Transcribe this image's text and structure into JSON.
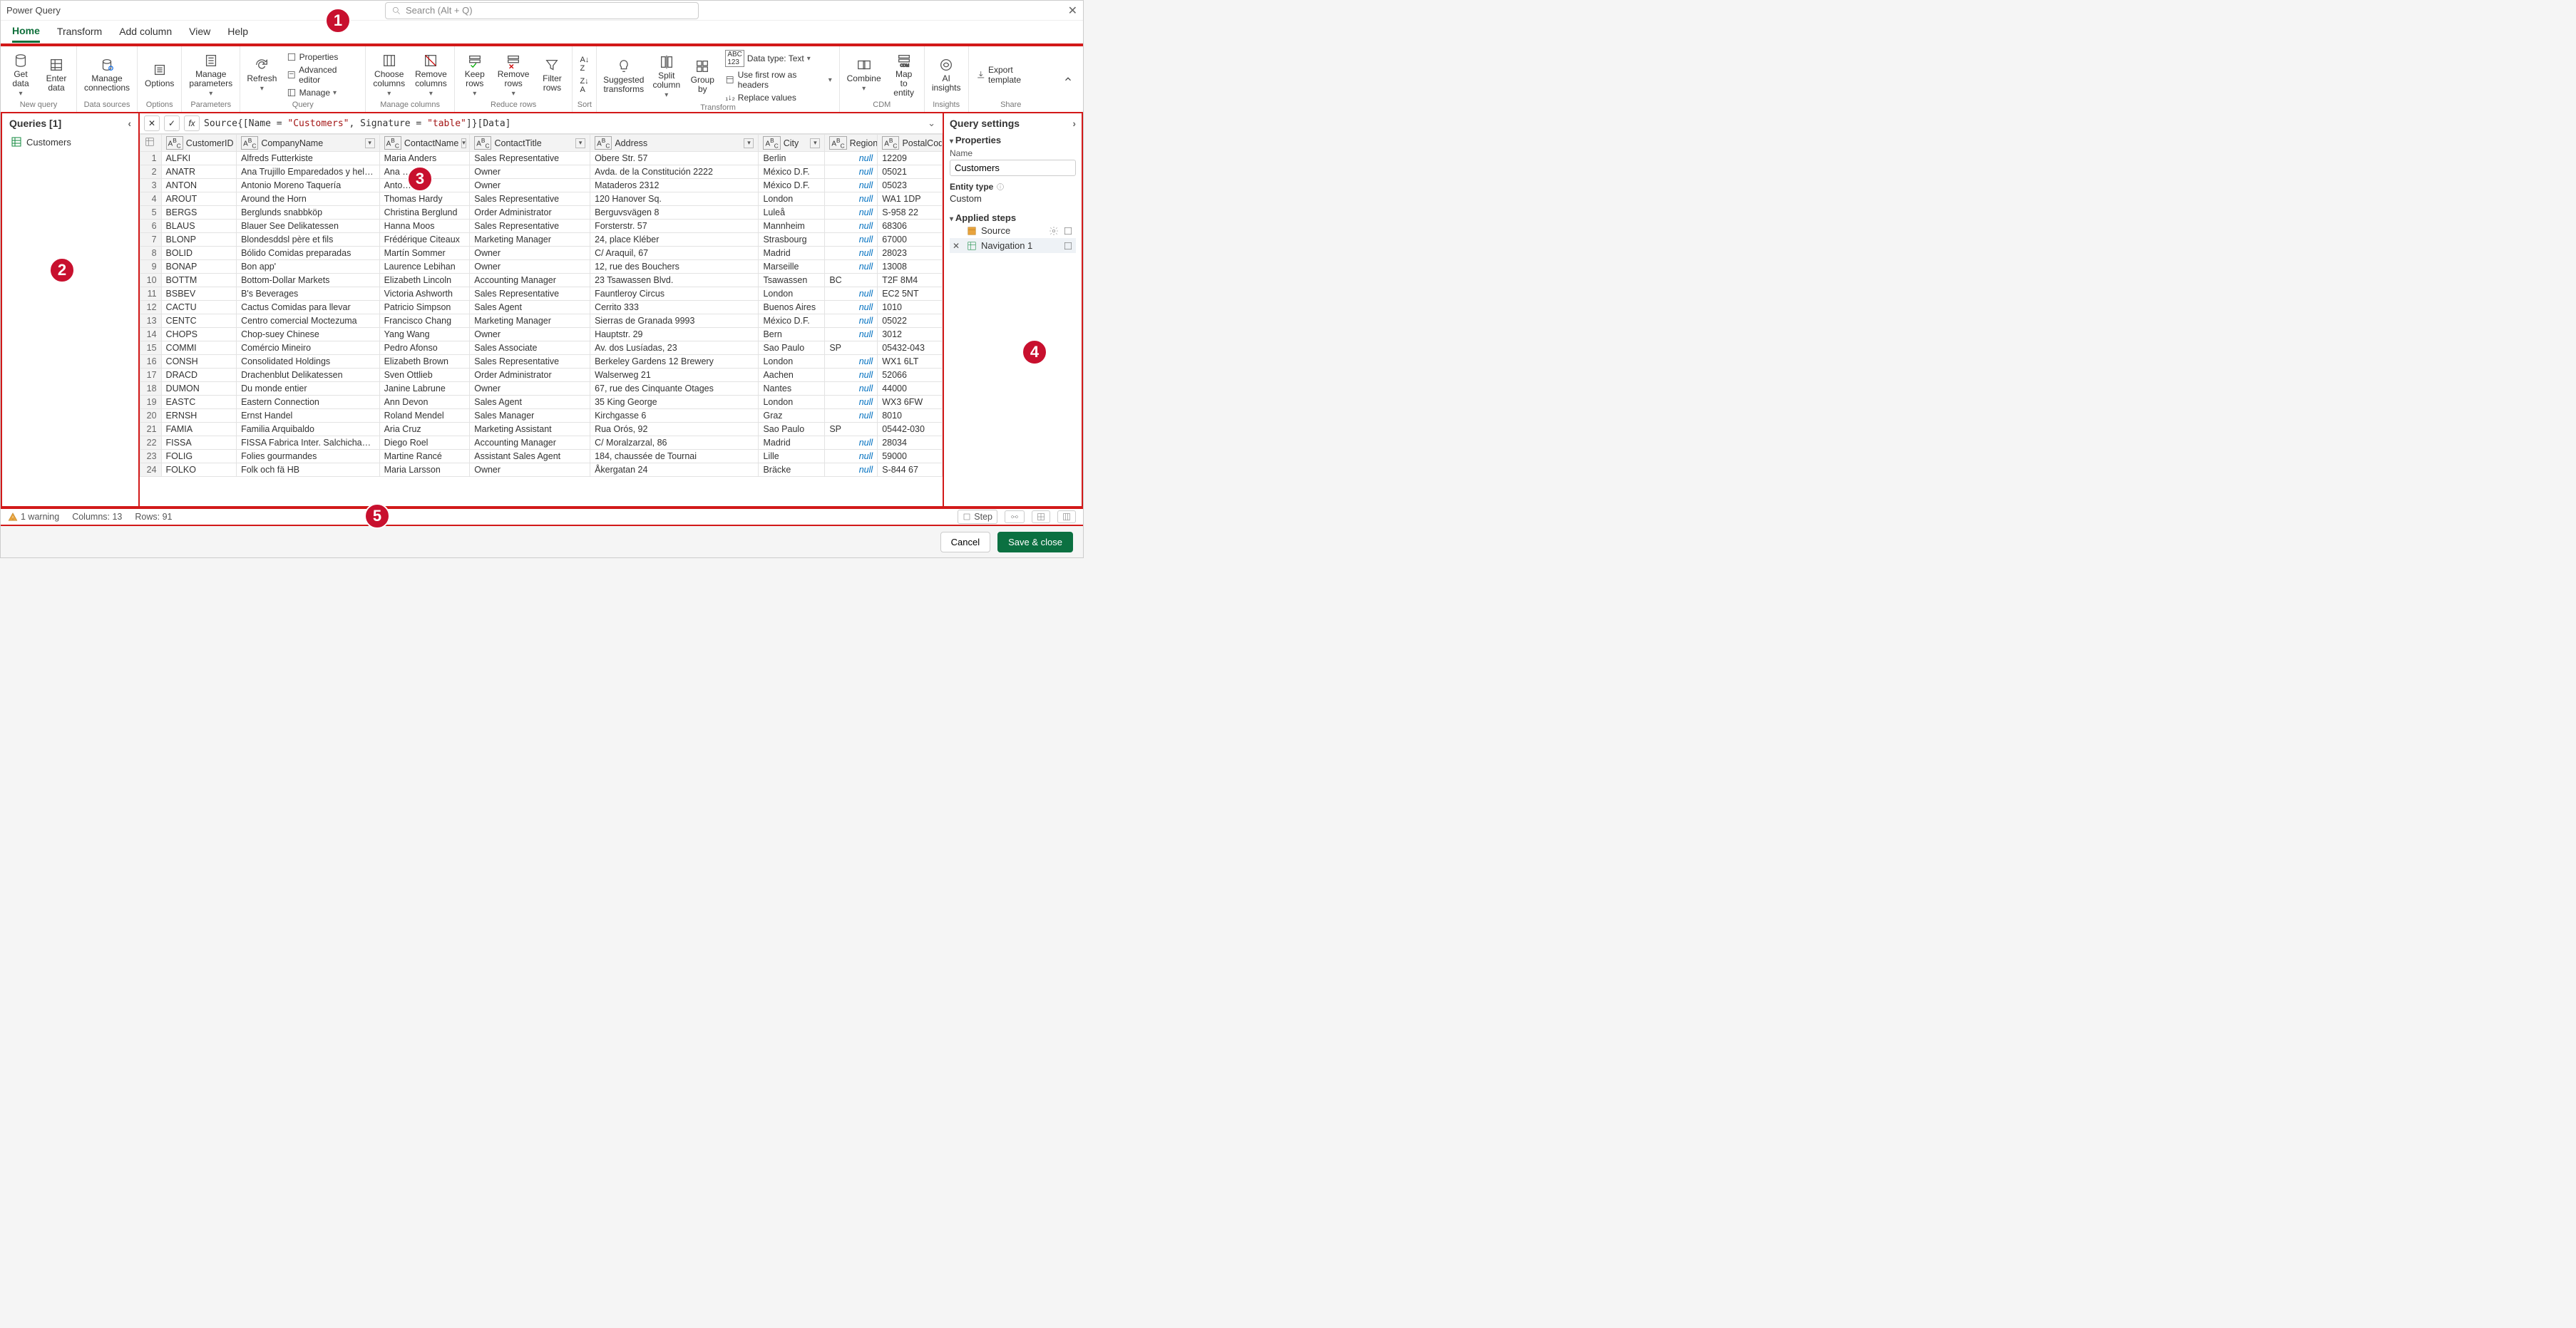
{
  "window": {
    "title": "Power Query"
  },
  "search": {
    "placeholder": "Search (Alt + Q)"
  },
  "tabs": [
    "Home",
    "Transform",
    "Add column",
    "View",
    "Help"
  ],
  "ribbon_groups": {
    "new_query": "New query",
    "data_sources": "Data sources",
    "options_g": "Options",
    "parameters": "Parameters",
    "query": "Query",
    "manage_columns": "Manage columns",
    "reduce_rows": "Reduce rows",
    "sort": "Sort",
    "transform": "Transform",
    "cdm": "CDM",
    "insights": "Insights",
    "share": "Share"
  },
  "ribbon": {
    "get_data": "Get\ndata",
    "enter_data": "Enter\ndata",
    "manage_connections": "Manage\nconnections",
    "options_btn": "Options",
    "manage_parameters": "Manage\nparameters",
    "refresh": "Refresh",
    "properties": "Properties",
    "advanced_editor": "Advanced editor",
    "manage": "Manage",
    "choose_columns": "Choose\ncolumns",
    "remove_columns": "Remove\ncolumns",
    "keep_rows": "Keep\nrows",
    "remove_rows": "Remove\nrows",
    "filter_rows": "Filter\nrows",
    "suggested": "Suggested\ntransforms",
    "split_column": "Split\ncolumn",
    "group_by": "Group\nby",
    "data_type": "Data type: Text",
    "first_row_headers": "Use first row as headers",
    "replace_values": "Replace values",
    "combine": "Combine",
    "map_to_entity": "Map to\nentity",
    "ai_insights": "AI\ninsights",
    "export_template": "Export template"
  },
  "sort_icons": {
    "asc": "A→Z",
    "desc": "Z→A"
  },
  "queries_pane": {
    "title": "Queries [1]",
    "items": [
      "Customers"
    ]
  },
  "formula": {
    "prefix": "Source{[Name = ",
    "v1": "\"Customers\"",
    "mid": ", Signature = ",
    "v2": "\"table\"",
    "suffix": "]}[Data]"
  },
  "columns": [
    "CustomerID",
    "CompanyName",
    "ContactName",
    "ContactTitle",
    "Address",
    "City",
    "Region",
    "PostalCode"
  ],
  "rows": [
    [
      "ALFKI",
      "Alfreds Futterkiste",
      "Maria Anders",
      "Sales Representative",
      "Obere Str. 57",
      "Berlin",
      null,
      "12209"
    ],
    [
      "ANATR",
      "Ana Trujillo Emparedados y helados",
      "Ana …",
      "Owner",
      "Avda. de la Constitución 2222",
      "México D.F.",
      null,
      "05021"
    ],
    [
      "ANTON",
      "Antonio Moreno Taquería",
      "Anto…",
      "Owner",
      "Mataderos  2312",
      "México D.F.",
      null,
      "05023"
    ],
    [
      "AROUT",
      "Around the Horn",
      "Thomas Hardy",
      "Sales Representative",
      "120 Hanover Sq.",
      "London",
      null,
      "WA1 1DP"
    ],
    [
      "BERGS",
      "Berglunds snabbköp",
      "Christina Berglund",
      "Order Administrator",
      "Berguvsvägen  8",
      "Luleå",
      null,
      "S-958 22"
    ],
    [
      "BLAUS",
      "Blauer See Delikatessen",
      "Hanna Moos",
      "Sales Representative",
      "Forsterstr. 57",
      "Mannheim",
      null,
      "68306"
    ],
    [
      "BLONP",
      "Blondesddsl père et fils",
      "Frédérique Citeaux",
      "Marketing Manager",
      "24, place Kléber",
      "Strasbourg",
      null,
      "67000"
    ],
    [
      "BOLID",
      "Bólido Comidas preparadas",
      "Martín Sommer",
      "Owner",
      "C/ Araquil, 67",
      "Madrid",
      null,
      "28023"
    ],
    [
      "BONAP",
      "Bon app'",
      "Laurence Lebihan",
      "Owner",
      "12, rue des Bouchers",
      "Marseille",
      null,
      "13008"
    ],
    [
      "BOTTM",
      "Bottom-Dollar Markets",
      "Elizabeth Lincoln",
      "Accounting Manager",
      "23 Tsawassen Blvd.",
      "Tsawassen",
      "BC",
      "T2F 8M4"
    ],
    [
      "BSBEV",
      "B's Beverages",
      "Victoria Ashworth",
      "Sales Representative",
      "Fauntleroy Circus",
      "London",
      null,
      "EC2 5NT"
    ],
    [
      "CACTU",
      "Cactus Comidas para llevar",
      "Patricio Simpson",
      "Sales Agent",
      "Cerrito 333",
      "Buenos Aires",
      null,
      "1010"
    ],
    [
      "CENTC",
      "Centro comercial Moctezuma",
      "Francisco Chang",
      "Marketing Manager",
      "Sierras de Granada 9993",
      "México D.F.",
      null,
      "05022"
    ],
    [
      "CHOPS",
      "Chop-suey Chinese",
      "Yang Wang",
      "Owner",
      "Hauptstr. 29",
      "Bern",
      null,
      "3012"
    ],
    [
      "COMMI",
      "Comércio Mineiro",
      "Pedro Afonso",
      "Sales Associate",
      "Av. dos Lusíadas, 23",
      "Sao Paulo",
      "SP",
      "05432-043"
    ],
    [
      "CONSH",
      "Consolidated Holdings",
      "Elizabeth Brown",
      "Sales Representative",
      "Berkeley Gardens 12  Brewery",
      "London",
      null,
      "WX1 6LT"
    ],
    [
      "DRACD",
      "Drachenblut Delikatessen",
      "Sven Ottlieb",
      "Order Administrator",
      "Walserweg 21",
      "Aachen",
      null,
      "52066"
    ],
    [
      "DUMON",
      "Du monde entier",
      "Janine Labrune",
      "Owner",
      "67, rue des Cinquante Otages",
      "Nantes",
      null,
      "44000"
    ],
    [
      "EASTC",
      "Eastern Connection",
      "Ann Devon",
      "Sales Agent",
      "35 King George",
      "London",
      null,
      "WX3 6FW"
    ],
    [
      "ERNSH",
      "Ernst Handel",
      "Roland Mendel",
      "Sales Manager",
      "Kirchgasse 6",
      "Graz",
      null,
      "8010"
    ],
    [
      "FAMIA",
      "Familia Arquibaldo",
      "Aria Cruz",
      "Marketing Assistant",
      "Rua Orós, 92",
      "Sao Paulo",
      "SP",
      "05442-030"
    ],
    [
      "FISSA",
      "FISSA Fabrica Inter. Salchichas S.A.",
      "Diego Roel",
      "Accounting Manager",
      "C/ Moralzarzal, 86",
      "Madrid",
      null,
      "28034"
    ],
    [
      "FOLIG",
      "Folies gourmandes",
      "Martine Rancé",
      "Assistant Sales Agent",
      "184, chaussée de Tournai",
      "Lille",
      null,
      "59000"
    ],
    [
      "FOLKO",
      "Folk och fä HB",
      "Maria Larsson",
      "Owner",
      "Åkergatan 24",
      "Bräcke",
      null,
      "S-844 67"
    ]
  ],
  "settings": {
    "title": "Query settings",
    "properties": "Properties",
    "name_label": "Name",
    "name_value": "Customers",
    "entity_type_label": "Entity type",
    "entity_type_value": "Custom",
    "applied_steps": "Applied steps",
    "steps": [
      "Source",
      "Navigation 1"
    ]
  },
  "status": {
    "warning": "1 warning",
    "columns": "Columns: 13",
    "rows": "Rows: 91",
    "step_btn": "Step"
  },
  "footer": {
    "cancel": "Cancel",
    "save": "Save & close"
  },
  "null_text": "null",
  "badges": {
    "b1": "1",
    "b2": "2",
    "b3": "3",
    "b4": "4",
    "b5": "5"
  }
}
